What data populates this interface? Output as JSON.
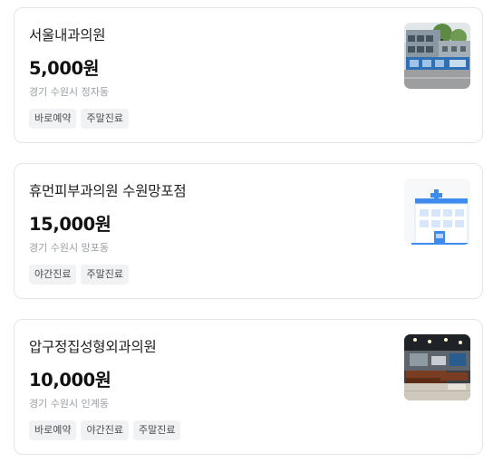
{
  "clinics": [
    {
      "name": "서울내과의원",
      "price": "5,000원",
      "address": "경기 수원시 정자동",
      "tags": [
        "바로예약",
        "주말진료"
      ],
      "thumbnail_icon": "clinic-building-photo"
    },
    {
      "name": "휴먼피부과의원 수원망포점",
      "price": "15,000원",
      "address": "경기 수원시 망포동",
      "tags": [
        "야간진료",
        "주말진료"
      ],
      "thumbnail_icon": "hospital-building-icon"
    },
    {
      "name": "압구정집성형외과의원",
      "price": "10,000원",
      "address": "경기 수원시 인계동",
      "tags": [
        "바로예약",
        "야간진료",
        "주말진료"
      ],
      "thumbnail_icon": "clinic-lobby-photo"
    }
  ],
  "colors": {
    "card_border": "#e3e5e8",
    "tag_background": "#f1f2f4",
    "address_text": "#9a9ea5",
    "hospital_icon_blue": "#3d8bef"
  }
}
